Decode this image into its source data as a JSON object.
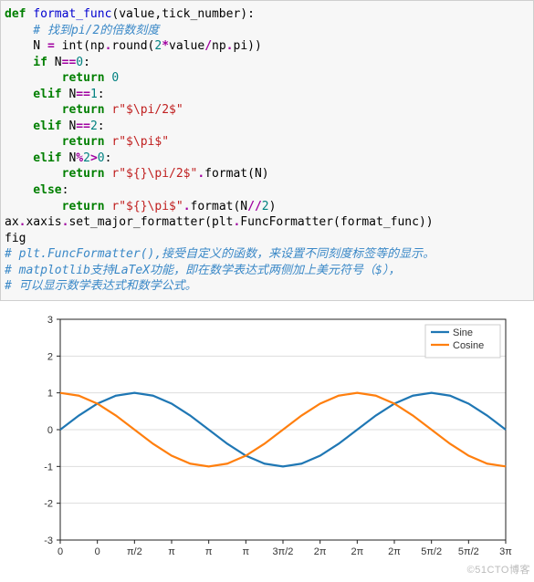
{
  "code": {
    "l1_def": "def",
    "l1_name": " format_func",
    "l1_rest": "(value,tick_number):",
    "l2_cmt": "    # 找到pi/2的倍数刻度",
    "l3a": "    N ",
    "l3eq": "=",
    "l3b": " int",
    "l3c": "(np",
    "l3dot1": ".",
    "l3d": "round(",
    "l3n2": "2",
    "l3star": "*",
    "l3e": "value",
    "l3slash": "/",
    "l3f": "np",
    "l3dot2": ".",
    "l3g": "pi))",
    "l4_if": "    if",
    "l4_rest": " N",
    "l4_eq": "==",
    "l4_n": "0",
    "l4_colon": ":",
    "l5_ret": "        return",
    "l5_sp": " ",
    "l5_n": "0",
    "l6_elif": "    elif",
    "l6_rest": " N",
    "l6_eq": "==",
    "l6_n": "1",
    "l6_colon": ":",
    "l7_ret": "        return",
    "l7_sp": " ",
    "l7_str": "r\"$\\pi/2$\"",
    "l8_elif": "    elif",
    "l8_rest": " N",
    "l8_eq": "==",
    "l8_n": "2",
    "l8_colon": ":",
    "l9_ret": "        return",
    "l9_sp": " ",
    "l9_str": "r\"$\\pi$\"",
    "l10_elif": "    elif",
    "l10_rest": " N",
    "l10_pct": "%",
    "l10_n2": "2",
    "l10_gt": ">",
    "l10_n0": "0",
    "l10_colon": ":",
    "l11_ret": "        return",
    "l11_sp": " ",
    "l11_str": "r\"${}\\pi/2$\"",
    "l11_dot": ".",
    "l11_fmt": "format(N)",
    "l12_else": "    else",
    "l12_colon": ":",
    "l13_ret": "        return",
    "l13_sp": " ",
    "l13_str": "r\"${}\\pi$\"",
    "l13_dot": ".",
    "l13_fmt": "format(N",
    "l13_dd": "//",
    "l13_n": "2",
    "l13_cp": ")",
    "l14": "ax",
    "l14_dot1": ".",
    "l14_b": "xaxis",
    "l14_dot2": ".",
    "l14_c": "set_major_formatter(plt",
    "l14_dot3": ".",
    "l14_d": "FuncFormatter(format_func))",
    "l15": "fig",
    "l16_cmt": "# plt.FuncFormatter(),接受自定义的函数，来设置不同刻度标签等的显示。",
    "l17_cmt": "# matplotlib支持LaTeX功能，即在数学表达式两侧加上美元符号（$），",
    "l18_cmt": "# 可以显示数学表达式和数学公式。"
  },
  "chart_data": {
    "type": "line",
    "title": "",
    "xlabel": "",
    "ylabel": "",
    "ylim": [
      -3,
      3
    ],
    "xlim": [
      0,
      9.42477
    ],
    "yticks": [
      -3,
      -2,
      -1,
      0,
      1,
      2,
      3
    ],
    "xticks_values": [
      0,
      0.7854,
      1.5708,
      2.3562,
      3.1416,
      3.927,
      4.7124,
      5.4978,
      6.2832,
      7.0686,
      7.854,
      8.6394,
      9.4248
    ],
    "xticks_labels": [
      "0",
      "0",
      "π/2",
      "π",
      "π",
      "π",
      "3π/2",
      "2π",
      "2π",
      "2π",
      "5π/2",
      "5π/2",
      "3π"
    ],
    "series": [
      {
        "name": "Sine",
        "color": "#1f77b4",
        "x": [
          0,
          0.393,
          0.785,
          1.178,
          1.571,
          1.963,
          2.356,
          2.749,
          3.142,
          3.534,
          3.927,
          4.32,
          4.712,
          5.105,
          5.498,
          5.89,
          6.283,
          6.676,
          7.069,
          7.461,
          7.854,
          8.247,
          8.639,
          9.032,
          9.425
        ],
        "y": [
          0,
          0.383,
          0.707,
          0.924,
          1,
          0.924,
          0.707,
          0.383,
          0,
          -0.383,
          -0.707,
          -0.924,
          -1,
          -0.924,
          -0.707,
          -0.383,
          0,
          0.383,
          0.707,
          0.924,
          1,
          0.924,
          0.707,
          0.383,
          0
        ]
      },
      {
        "name": "Cosine",
        "color": "#ff7f0e",
        "x": [
          0,
          0.393,
          0.785,
          1.178,
          1.571,
          1.963,
          2.356,
          2.749,
          3.142,
          3.534,
          3.927,
          4.32,
          4.712,
          5.105,
          5.498,
          5.89,
          6.283,
          6.676,
          7.069,
          7.461,
          7.854,
          8.247,
          8.639,
          9.032,
          9.425
        ],
        "y": [
          1,
          0.924,
          0.707,
          0.383,
          0,
          -0.383,
          -0.707,
          -0.924,
          -1,
          -0.924,
          -0.707,
          -0.383,
          0,
          0.383,
          0.707,
          0.924,
          1,
          0.924,
          0.707,
          0.383,
          0,
          -0.383,
          -0.707,
          -0.924,
          -1
        ]
      }
    ],
    "legend": {
      "position": "upper-right",
      "entries": [
        "Sine",
        "Cosine"
      ]
    }
  },
  "watermark": "©51CTO博客"
}
